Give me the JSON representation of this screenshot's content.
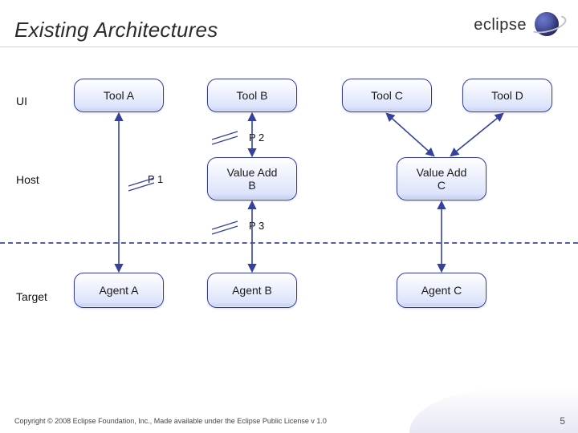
{
  "brand": "eclipse",
  "title": "Existing Architectures",
  "labels": {
    "ui": "UI",
    "host": "Host",
    "target": "Target",
    "p1": "P 1",
    "p2": "P 2",
    "p3": "P 3"
  },
  "nodes": {
    "toolA": "Tool A",
    "toolB": "Tool B",
    "toolC": "Tool C",
    "toolD": "Tool D",
    "valB": "Value Add\nB",
    "valC": "Value Add\nC",
    "agentA": "Agent A",
    "agentB": "Agent B",
    "agentC": "Agent C"
  },
  "footer": "Copyright © 2008 Eclipse Foundation, Inc., Made available under the Eclipse Public License v 1.0",
  "page": "5"
}
